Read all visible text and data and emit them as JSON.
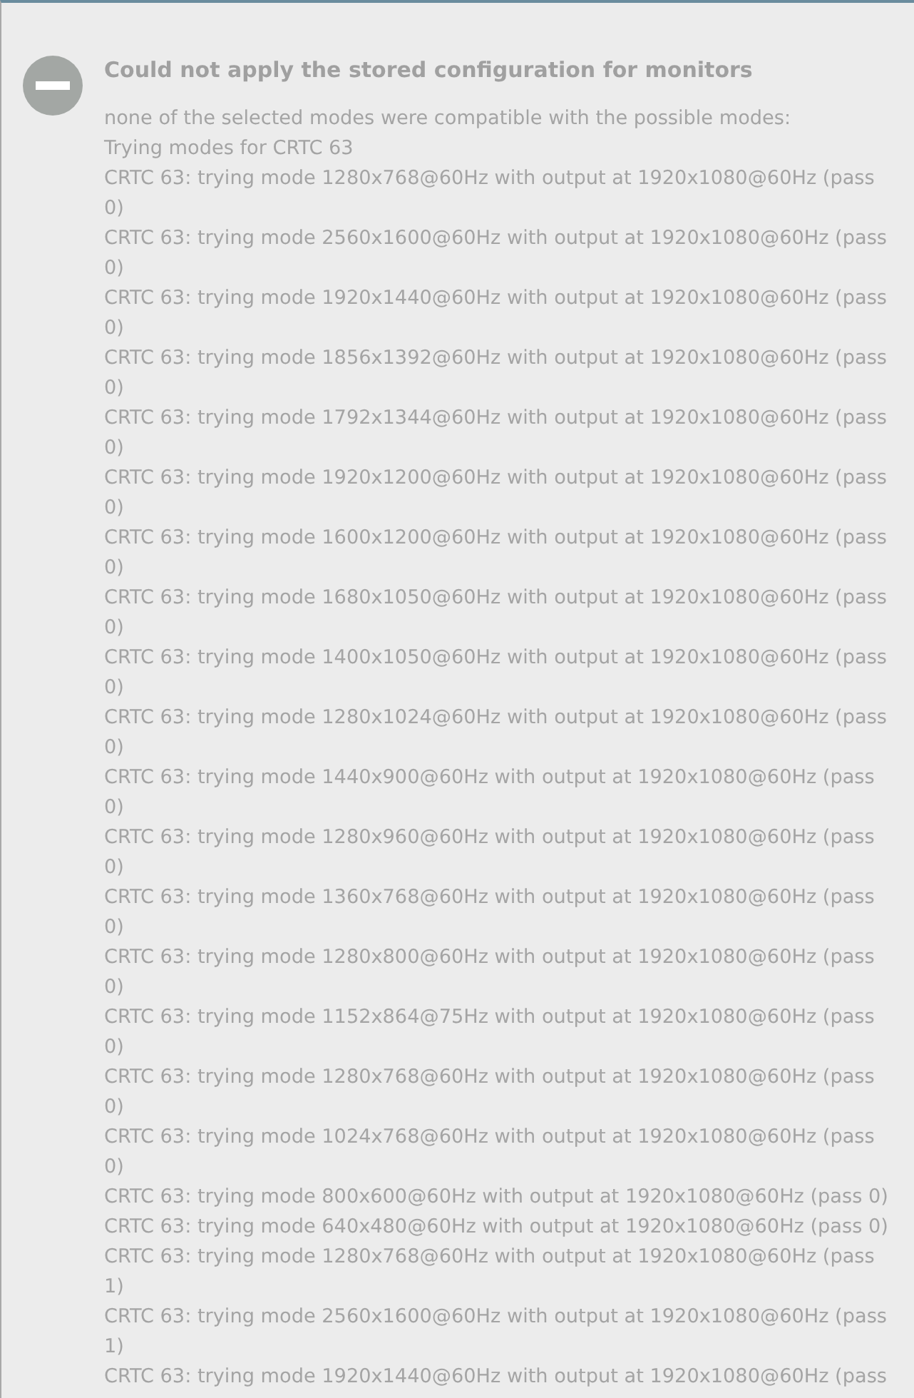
{
  "dialog": {
    "kind": "error",
    "title": "Could not apply the stored configuration for monitors",
    "message_lines": [
      "none of the selected modes were compatible with the possible modes:",
      "Trying modes for CRTC 63",
      "CRTC 63: trying mode 1280x768@60Hz with output at 1920x1080@60Hz (pass 0)",
      "CRTC 63: trying mode 2560x1600@60Hz with output at 1920x1080@60Hz (pass 0)",
      "CRTC 63: trying mode 1920x1440@60Hz with output at 1920x1080@60Hz (pass 0)",
      "CRTC 63: trying mode 1856x1392@60Hz with output at 1920x1080@60Hz (pass 0)",
      "CRTC 63: trying mode 1792x1344@60Hz with output at 1920x1080@60Hz (pass 0)",
      "CRTC 63: trying mode 1920x1200@60Hz with output at 1920x1080@60Hz (pass 0)",
      "CRTC 63: trying mode 1600x1200@60Hz with output at 1920x1080@60Hz (pass 0)",
      "CRTC 63: trying mode 1680x1050@60Hz with output at 1920x1080@60Hz (pass 0)",
      "CRTC 63: trying mode 1400x1050@60Hz with output at 1920x1080@60Hz (pass 0)",
      "CRTC 63: trying mode 1280x1024@60Hz with output at 1920x1080@60Hz (pass 0)",
      "CRTC 63: trying mode 1440x900@60Hz with output at 1920x1080@60Hz (pass 0)",
      "CRTC 63: trying mode 1280x960@60Hz with output at 1920x1080@60Hz (pass 0)",
      "CRTC 63: trying mode 1360x768@60Hz with output at 1920x1080@60Hz (pass 0)",
      "CRTC 63: trying mode 1280x800@60Hz with output at 1920x1080@60Hz (pass 0)",
      "CRTC 63: trying mode 1152x864@75Hz with output at 1920x1080@60Hz (pass 0)",
      "CRTC 63: trying mode 1280x768@60Hz with output at 1920x1080@60Hz (pass 0)",
      "CRTC 63: trying mode 1024x768@60Hz with output at 1920x1080@60Hz (pass 0)",
      "CRTC 63: trying mode 800x600@60Hz with output at 1920x1080@60Hz (pass 0)",
      "CRTC 63: trying mode 640x480@60Hz with output at 1920x1080@60Hz (pass 0)",
      "CRTC 63: trying mode 1280x768@60Hz with output at 1920x1080@60Hz (pass 1)",
      "CRTC 63: trying mode 2560x1600@60Hz with output at 1920x1080@60Hz (pass 1)",
      "CRTC 63: trying mode 1920x1440@60Hz with output at 1920x1080@60Hz (pass"
    ]
  }
}
